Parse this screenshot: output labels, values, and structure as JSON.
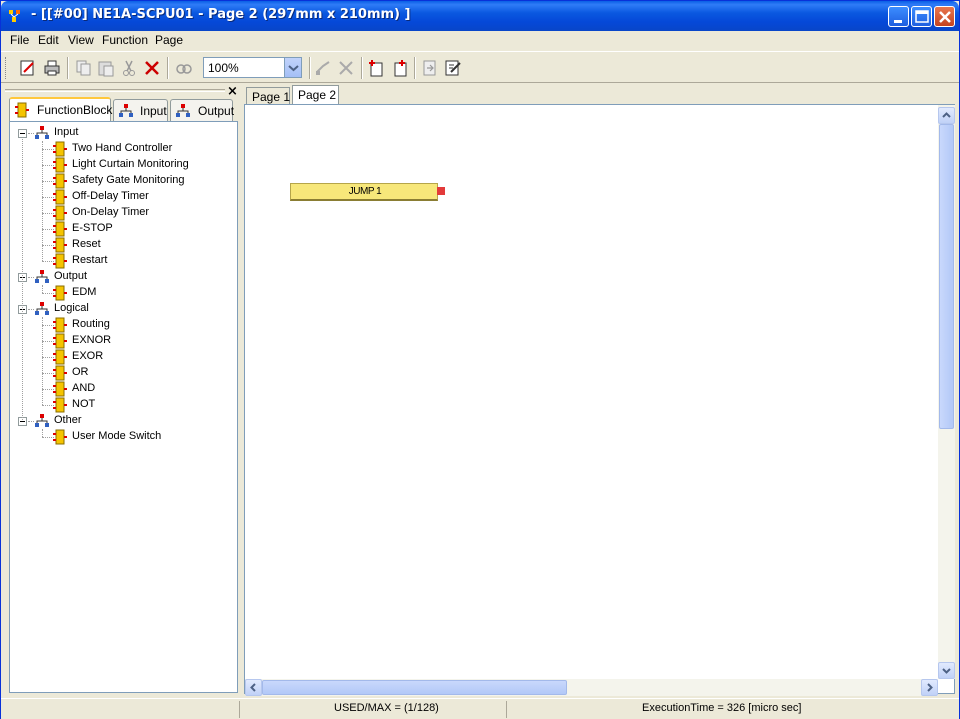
{
  "window": {
    "title": " - [[#00] NE1A-SCPU01 - Page 2 (297mm x 210mm) ]"
  },
  "menu": {
    "file": "File",
    "edit": "Edit",
    "view": "View",
    "function": "Function",
    "page": "Page"
  },
  "toolbar": {
    "zoom_value": "100%"
  },
  "left_panel": {
    "tabs": [
      {
        "label": "FunctionBlock",
        "active": true
      },
      {
        "label": "Input",
        "active": false
      },
      {
        "label": "Output",
        "active": false
      }
    ],
    "tree": [
      {
        "group": "Input",
        "items": [
          "Two Hand Controller",
          "Light Curtain Monitoring",
          "Safety Gate Monitoring",
          "Off-Delay Timer",
          "On-Delay Timer",
          "E-STOP",
          "Reset",
          "Restart"
        ]
      },
      {
        "group": "Output",
        "items": [
          "EDM"
        ]
      },
      {
        "group": "Logical",
        "items": [
          "Routing",
          "EXNOR",
          "EXOR",
          "OR",
          "AND",
          "NOT"
        ]
      },
      {
        "group": "Other",
        "items": [
          "User Mode Switch"
        ]
      }
    ]
  },
  "page_tabs": [
    {
      "label": "Page 1",
      "active": false
    },
    {
      "label": "Page 2",
      "active": true
    }
  ],
  "canvas": {
    "block_label": "JUMP 1"
  },
  "status": {
    "used_max": "USED/MAX = (1/128)",
    "execution_time": "ExecutionTime = 326 [micro sec]"
  },
  "colors": {
    "titlebar": "#0a58e0",
    "block_fill": "#f7e77a",
    "port_red": "#e33a3a",
    "tree_icon": "#f5c400"
  }
}
